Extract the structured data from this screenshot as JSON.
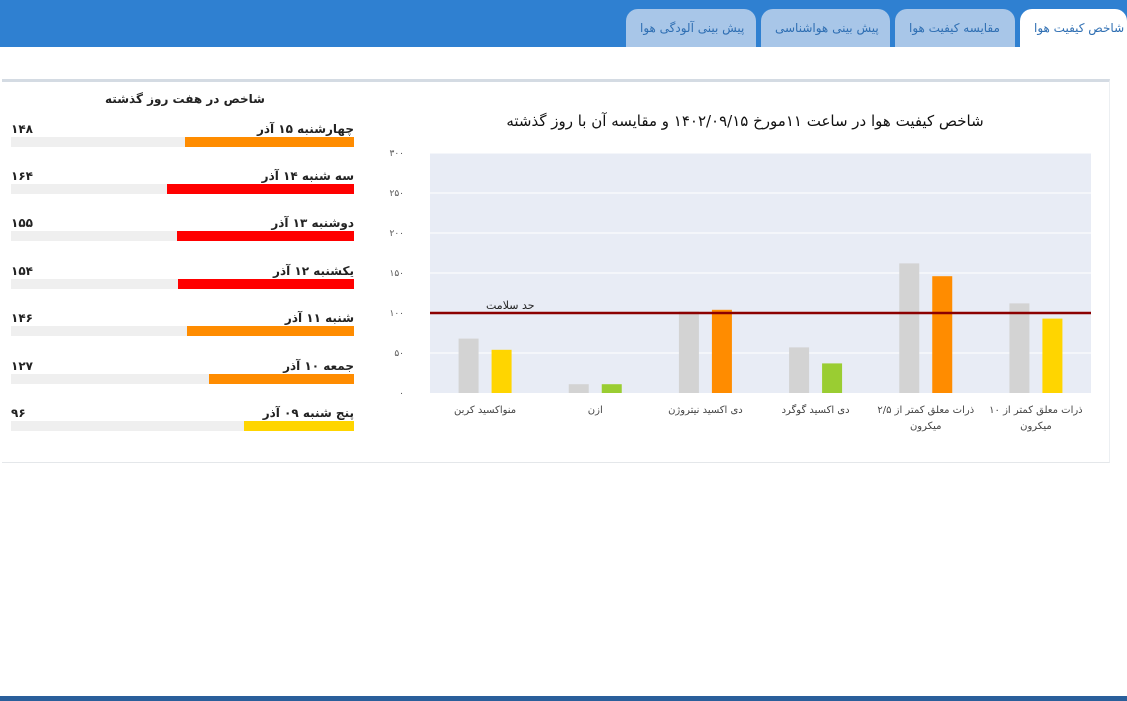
{
  "tabs": [
    {
      "label": "شاخص کیفیت هوا",
      "active": true
    },
    {
      "label": "مقایسه کیفیت هوا",
      "active": false
    },
    {
      "label": "پیش بینی هواشناسی",
      "active": false
    },
    {
      "label": "پیش بینی آلودگی هوا",
      "active": false
    }
  ],
  "history": {
    "title": "شاخص در هفت روز گذشته",
    "max": 300,
    "days": [
      {
        "label": "چهارشنبه ۱۵ آذر",
        "value_text": "۱۴۸",
        "value": 148,
        "color": "#ff8c00"
      },
      {
        "label": "سه شنبه ۱۴ آذر",
        "value_text": "۱۶۴",
        "value": 164,
        "color": "#ff0000"
      },
      {
        "label": "دوشنبه ۱۳ آذر",
        "value_text": "۱۵۵",
        "value": 155,
        "color": "#ff0000"
      },
      {
        "label": "یکشنبه ۱۲ آذر",
        "value_text": "۱۵۴",
        "value": 154,
        "color": "#ff0000"
      },
      {
        "label": "شنبه ۱۱ آذر",
        "value_text": "۱۴۶",
        "value": 146,
        "color": "#ff8c00"
      },
      {
        "label": "جمعه ۱۰ آذر",
        "value_text": "۱۲۷",
        "value": 127,
        "color": "#ff8c00"
      },
      {
        "label": "پنج شنبه ۰۹ آذر",
        "value_text": "۹۶",
        "value": 96,
        "color": "#ffd500"
      }
    ]
  },
  "chart_data": {
    "type": "bar",
    "title": "شاخص کیفیت هوا در ساعت ۱۱مورخ ۱۴۰۲/۰۹/۱۵ و مقایسه آن با روز گذشته",
    "xlabel": "",
    "ylabel": "",
    "ylim": [
      0,
      300
    ],
    "yticks": [
      {
        "value": 0,
        "label": "۰"
      },
      {
        "value": 50,
        "label": "۵۰"
      },
      {
        "value": 100,
        "label": "۱۰۰"
      },
      {
        "value": 150,
        "label": "۱۵۰"
      },
      {
        "value": 200,
        "label": "۲۰۰"
      },
      {
        "value": 250,
        "label": "۲۵۰"
      },
      {
        "value": 300,
        "label": "۳۰۰"
      }
    ],
    "grid": true,
    "health_limit": {
      "value": 100,
      "label": "حد سلامت",
      "color": "#8b0000"
    },
    "categories": [
      [
        "منواکسید کربن"
      ],
      [
        "ازن"
      ],
      [
        "دی اکسید نیتروژن"
      ],
      [
        "دی اکسید گوگرد"
      ],
      [
        "ذرات معلق کمتر از ۲/۵",
        "میکرون"
      ],
      [
        "ذرات معلق کمتر از ۱۰",
        "میکرون"
      ]
    ],
    "series": [
      {
        "values": [
          68,
          11,
          102,
          57,
          162,
          112
        ],
        "colors": [
          "#d3d3d3",
          "#d3d3d3",
          "#d3d3d3",
          "#d3d3d3",
          "#d3d3d3",
          "#d3d3d3"
        ]
      },
      {
        "values": [
          54,
          11,
          104,
          37,
          146,
          93
        ],
        "colors": [
          "#ffd500",
          "#9acd32",
          "#ff8c00",
          "#9acd32",
          "#ff8c00",
          "#ffd500"
        ]
      }
    ]
  }
}
